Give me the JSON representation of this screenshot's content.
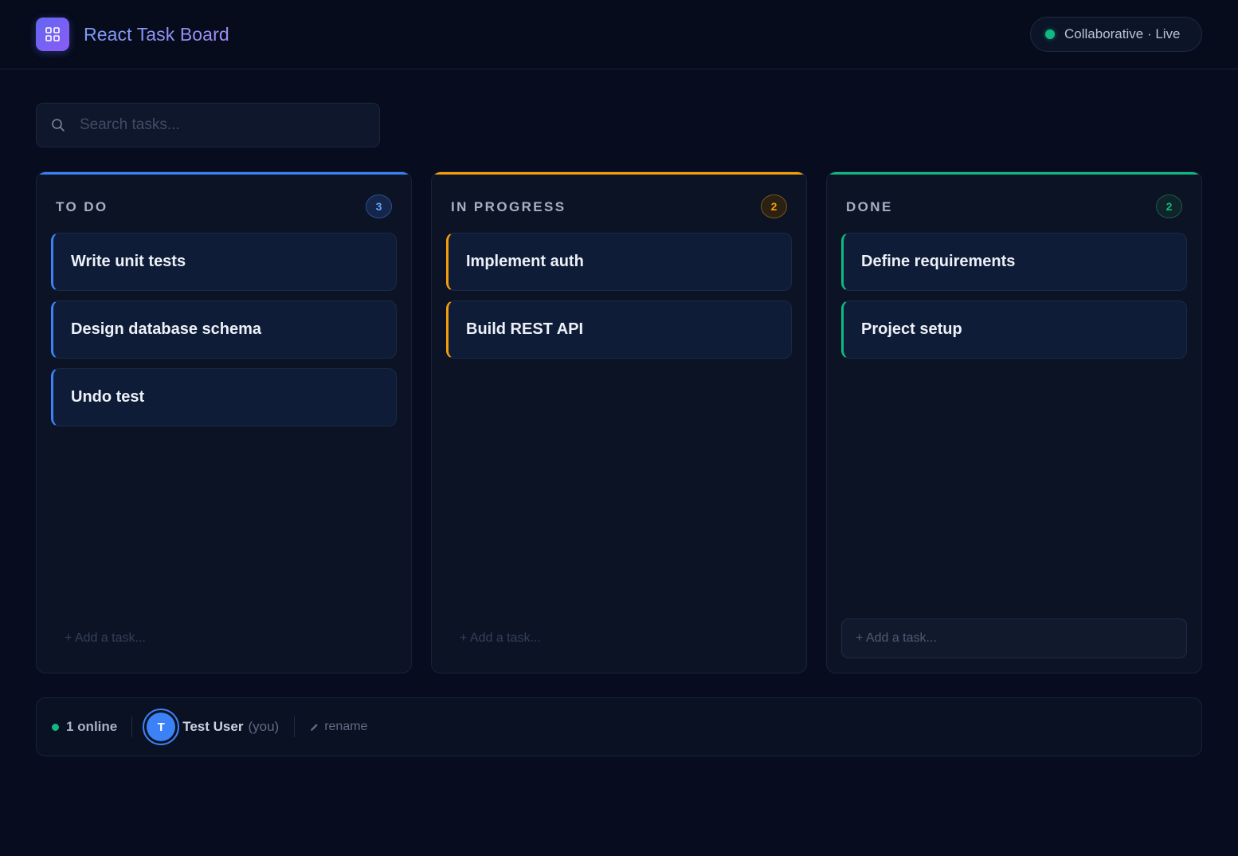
{
  "header": {
    "app_title": "React Task Board",
    "status_label": "Collaborative · Live",
    "status_color": "#10b981"
  },
  "search": {
    "placeholder": "Search tasks..."
  },
  "columns": [
    {
      "title": "TO DO",
      "count": "3",
      "accent": "#3b82f6",
      "tasks": [
        "Write unit tests",
        "Design database schema",
        "Undo test"
      ],
      "add_placeholder": "+ Add a task..."
    },
    {
      "title": "IN PROGRESS",
      "count": "2",
      "accent": "#f59e0b",
      "tasks": [
        "Implement auth",
        "Build REST API"
      ],
      "add_placeholder": "+ Add a task..."
    },
    {
      "title": "DONE",
      "count": "2",
      "accent": "#10b981",
      "tasks": [
        "Define requirements",
        "Project setup"
      ],
      "add_placeholder": "+ Add a task..."
    }
  ],
  "footer": {
    "online_count": "1 online",
    "avatar_initial": "T",
    "user_name": "Test User",
    "user_tag": "(you)",
    "rename_label": "rename"
  }
}
